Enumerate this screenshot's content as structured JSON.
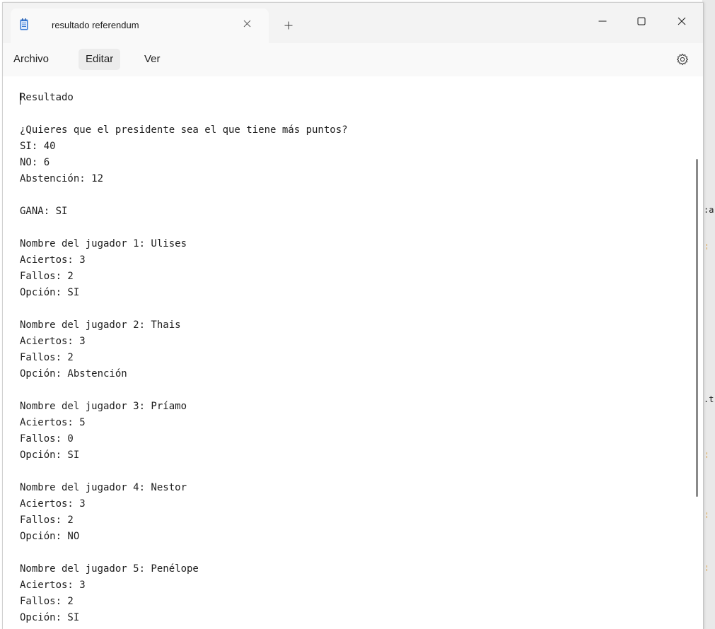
{
  "window": {
    "tab_title": "resultado referendum",
    "tab_close_icon": "close-icon",
    "new_tab_icon": "plus-icon",
    "app_icon": "notepad-icon",
    "controls": [
      "minimize-icon",
      "maximize-icon",
      "close-icon"
    ]
  },
  "menu": {
    "items": [
      {
        "label": "Archivo",
        "active": false
      },
      {
        "label": "Editar",
        "active": true
      },
      {
        "label": "Ver",
        "active": false
      }
    ],
    "settings_icon": "gear-icon"
  },
  "document": {
    "lines": [
      "Resultado",
      "",
      "¿Quieres que el presidente sea el que tiene más puntos?",
      "SI: 40",
      "NO: 6",
      "Abstención: 12",
      "",
      "GANA: SI",
      "",
      "Nombre del jugador 1: Ulises",
      "Aciertos: 3",
      "Fallos: 2",
      "Opción: SI",
      "",
      "Nombre del jugador 2: Thais",
      "Aciertos: 3",
      "Fallos: 2",
      "Opción: Abstención",
      "",
      "Nombre del jugador 3: Príamo",
      "Aciertos: 5",
      "Fallos: 0",
      "Opción: SI",
      "",
      "Nombre del jugador 4: Nestor",
      "Aciertos: 3",
      "Fallos: 2",
      "Opción: NO",
      "",
      "Nombre del jugador 5: Penélope",
      "Aciertos: 3",
      "Fallos: 2",
      "Opción: SI"
    ]
  },
  "colors": {
    "titlebar": "#f3f3f3",
    "menubar": "#f9f9f9",
    "editor_bg": "#ffffff",
    "text": "#1e1e1e"
  }
}
